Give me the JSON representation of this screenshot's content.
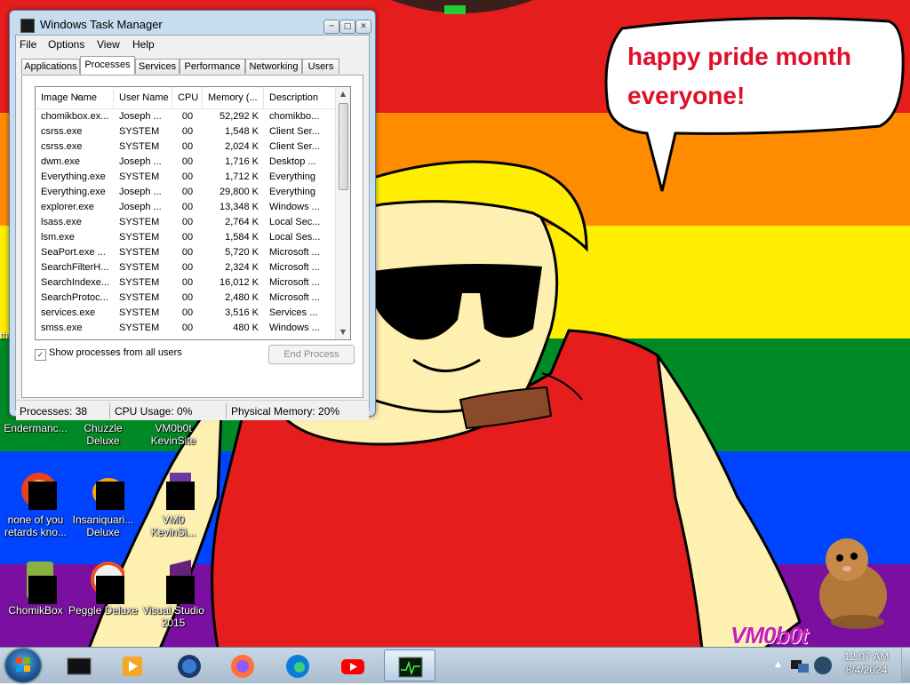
{
  "wallpaper": {
    "colors": {
      "red": "#e51d1d",
      "orange": "#ff8c00",
      "yellow": "#ffee00",
      "green": "#008a26",
      "blue": "#0044ff",
      "purple": "#7a0fa0",
      "skin": "#fdf0b0",
      "shirt": "#e51d1d"
    },
    "speech": "happy pride month everyone!",
    "watermark": "VM0b0t",
    "stray_text": "th"
  },
  "desktop_icons": [
    {
      "label": "Endermanc...",
      "icon": "folder-icon"
    },
    {
      "label": "Chuzzle\nDeluxe",
      "icon": "chuzzle-icon"
    },
    {
      "label": "VM0b0t\nKevinSite",
      "icon": "shortcut-icon"
    },
    {
      "label": "none of you\nretards kno...",
      "icon": "firefox-like-icon"
    },
    {
      "label": "Insaniquari...\nDeluxe",
      "icon": "insaniquarium-icon"
    },
    {
      "label": "VM0\nKevinSi...",
      "icon": "document-icon"
    },
    {
      "label": "ChomikBox",
      "icon": "chomikbox-icon"
    },
    {
      "label": "Peggle Deluxe",
      "icon": "peggle-icon"
    },
    {
      "label": "Visual Studio\n2015",
      "icon": "visual-studio-icon"
    }
  ],
  "task_manager": {
    "title": "Windows Task Manager",
    "controls": {
      "minimize": "─",
      "maximize": "□",
      "close": "✕"
    },
    "menu": [
      "File",
      "Options",
      "View",
      "Help"
    ],
    "tabs": [
      "Applications",
      "Processes",
      "Services",
      "Performance",
      "Networking",
      "Users"
    ],
    "active_tab": "Processes",
    "columns": [
      "Image Name",
      "User Name",
      "CPU",
      "Memory (...",
      "Description"
    ],
    "rows": [
      [
        "chomikbox.ex...",
        "Joseph ...",
        "00",
        "52,292 K",
        "chomikbo..."
      ],
      [
        "csrss.exe",
        "SYSTEM",
        "00",
        "1,548 K",
        "Client Ser..."
      ],
      [
        "csrss.exe",
        "SYSTEM",
        "00",
        "2,024 K",
        "Client Ser..."
      ],
      [
        "dwm.exe",
        "Joseph ...",
        "00",
        "1,716 K",
        "Desktop ..."
      ],
      [
        "Everything.exe",
        "SYSTEM",
        "00",
        "1,712 K",
        "Everything"
      ],
      [
        "Everything.exe",
        "Joseph ...",
        "00",
        "29,800 K",
        "Everything"
      ],
      [
        "explorer.exe",
        "Joseph ...",
        "00",
        "13,348 K",
        "Windows ..."
      ],
      [
        "lsass.exe",
        "SYSTEM",
        "00",
        "2,764 K",
        "Local Sec..."
      ],
      [
        "lsm.exe",
        "SYSTEM",
        "00",
        "1,584 K",
        "Local Ses..."
      ],
      [
        "SeaPort.exe ...",
        "SYSTEM",
        "00",
        "5,720 K",
        "Microsoft ..."
      ],
      [
        "SearchFilterH...",
        "SYSTEM",
        "00",
        "2,324 K",
        "Microsoft ..."
      ],
      [
        "SearchIndexe...",
        "SYSTEM",
        "00",
        "16,012 K",
        "Microsoft ..."
      ],
      [
        "SearchProtoc...",
        "SYSTEM",
        "00",
        "2,480 K",
        "Microsoft ..."
      ],
      [
        "services.exe",
        "SYSTEM",
        "00",
        "3,516 K",
        "Services ..."
      ],
      [
        "smss.exe",
        "SYSTEM",
        "00",
        "480 K",
        "Windows ..."
      ]
    ],
    "show_all_label": "Show processes from all users",
    "show_all_checked": "✓",
    "end_process": "End Process",
    "status": {
      "processes": "Processes: 38",
      "cpu": "CPU Usage: 0%",
      "memory": "Physical Memory: 20%"
    }
  },
  "taskbar": {
    "items": [
      {
        "name": "cmd-icon"
      },
      {
        "name": "media-player-icon"
      },
      {
        "name": "globe-icon"
      },
      {
        "name": "firefox-icon"
      },
      {
        "name": "edge-icon"
      },
      {
        "name": "youtube-icon"
      },
      {
        "name": "task-manager-icon",
        "active": true
      }
    ],
    "clock_time": "12:07 AM",
    "clock_date": "8/4/2024",
    "tray_arrow": "▲"
  }
}
